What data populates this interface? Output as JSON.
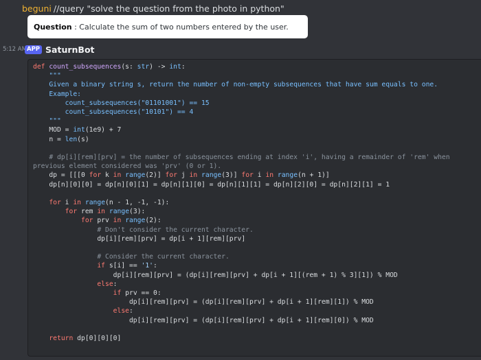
{
  "reply": {
    "username": "beguni",
    "command": "//query \"solve the question from the photo in python\""
  },
  "question_card": {
    "label": "Question",
    "text": " : Calculate the sum of two numbers entered by the user."
  },
  "message": {
    "timestamp": "5:12 AM",
    "badge": "APP",
    "author": "SaturnBot"
  },
  "code": {
    "language": "python",
    "lines": [
      "def count_subsequences(s: str) -> int:",
      "    \"\"\"",
      "    Given a binary string s, return the number of non-empty subsequences that have sum equals to one.",
      "",
      "    Example:",
      "        count_subsequences(\"01101001\") == 15",
      "        count_subsequences(\"10101\") == 4",
      "    \"\"\"",
      "    MOD = int(1e9) + 7",
      "    n = len(s)",
      "",
      "    # dp[i][rem][prv] = the number of subsequences ending at index 'i', having a remainder of 'rem' when",
      "previous element considered was 'prv' (0 or 1).",
      "    dp = [[[0 for k in range(2)] for j in range(3)] for i in range(n + 1)]",
      "    dp[n][0][0] = dp[n][0][1] = dp[n][1][0] = dp[n][1][1] = dp[n][2][0] = dp[n][2][1] = 1",
      "",
      "    for i in range(n - 1, -1, -1):",
      "        for rem in range(3):",
      "            for prv in range(2):",
      "                # Don't consider the current character.",
      "                dp[i][rem][prv] = dp[i + 1][rem][prv]",
      "",
      "                # Consider the current character.",
      "                if s[i] == '1':",
      "                    dp[i][rem][prv] = (dp[i][rem][prv] + dp[i + 1][(rem + 1) % 3][1]) % MOD",
      "                else:",
      "                    if prv == 0:",
      "                        dp[i][rem][prv] = (dp[i][rem][prv] + dp[i + 1][rem][1]) % MOD",
      "                    else:",
      "                        dp[i][rem][prv] = (dp[i][rem][prv] + dp[i + 1][rem][0]) % MOD",
      "",
      "    return dp[0][0][0]"
    ]
  }
}
